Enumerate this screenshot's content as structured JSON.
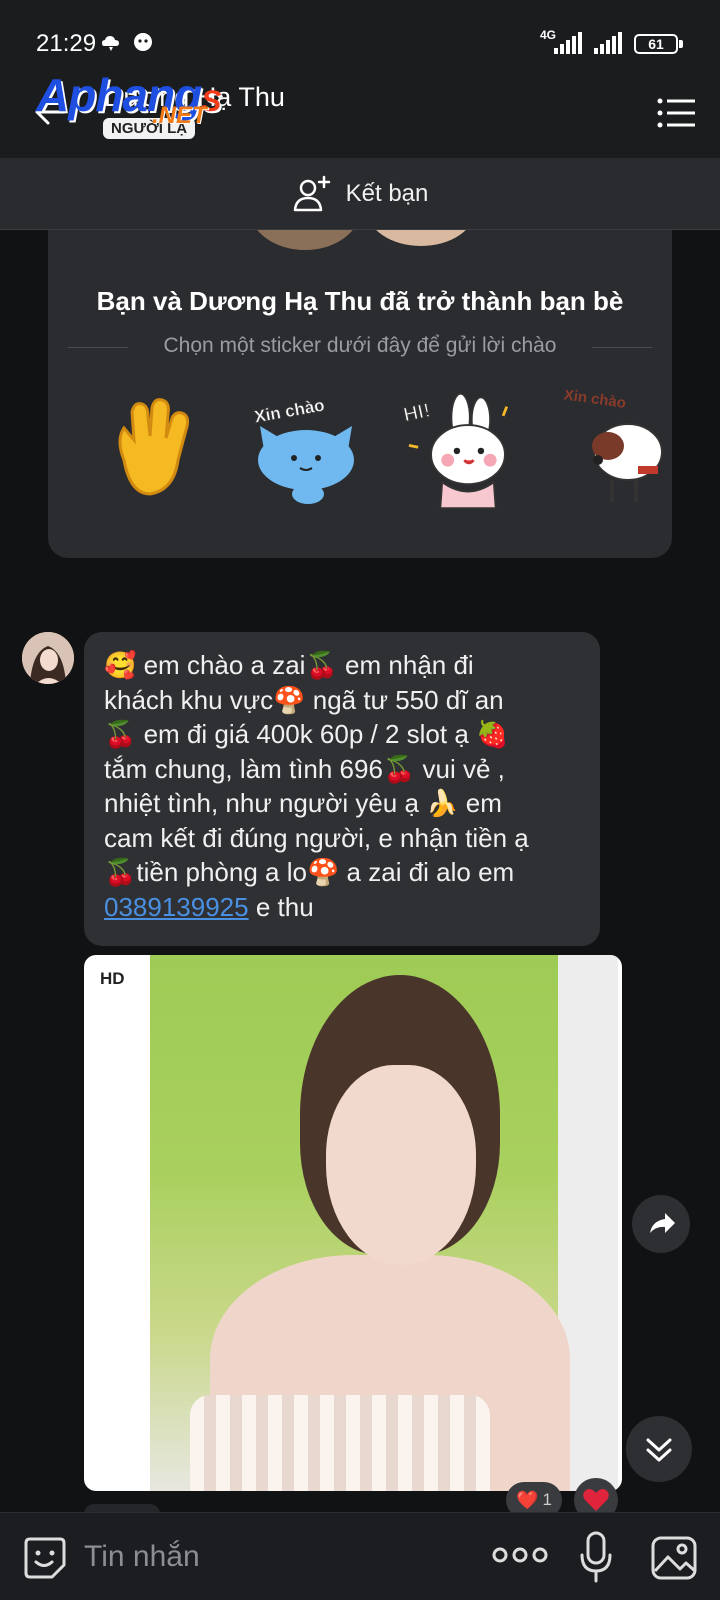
{
  "status_bar": {
    "time": "21:29",
    "network": "4G",
    "battery": "61"
  },
  "header": {
    "title": "Dương Hạ Thu",
    "stranger_badge": "NGƯỜI LẠ",
    "watermark_main": "Aphang",
    "watermark_s": "S",
    "watermark_net": ".NET"
  },
  "add_friend": {
    "label": "Kết bạn"
  },
  "friend_card": {
    "title": "Bạn và Dương Hạ Thu đã trở thành bạn bè",
    "subtitle": "Chọn một sticker dưới đây để gửi lời chào",
    "stickers": [
      {
        "name": "waving-hand"
      },
      {
        "name": "xin-chao-cat",
        "text": "Xin chào"
      },
      {
        "name": "hi-bunny",
        "text": "HI!"
      },
      {
        "name": "xin-chao-dog",
        "text": "Xin chào"
      }
    ]
  },
  "message": {
    "lines": [
      "🥰 em chào a zai🍒 em nhận đi",
      "khách khu vực🍄 ngã tư 550 dĩ an",
      "🍒 em đi giá 400k 60p / 2 slot ạ 🍓",
      "tắm chung, làm tình 696🍒 vui vẻ ,",
      "nhiệt tình, như người yêu ạ 🍌 em",
      "cam kết đi đúng người, e nhận tiền ạ",
      "🍒tiền phòng a lo🍄 a zai đi alo em"
    ],
    "phone": "0389139925",
    "tail": " e thu"
  },
  "photo": {
    "quality_label": "HD"
  },
  "reactions": {
    "count": "1",
    "heart": "❤️"
  },
  "input_bar": {
    "placeholder": "Tin nhắn"
  },
  "colors": {
    "background": "#111213",
    "bubble": "#2f3033",
    "link": "#4a90e2",
    "heart": "#e0243b"
  }
}
